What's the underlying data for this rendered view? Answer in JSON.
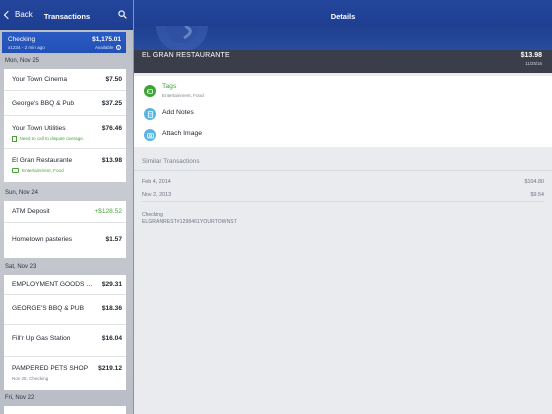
{
  "left_pane": {
    "back_label": "Back",
    "title": "Transactions",
    "account": {
      "name": "Checking",
      "balance": "$1,175.01",
      "sub": "x1234 - 2 min ago",
      "status": "Available"
    },
    "days": [
      {
        "label": "Mon, Nov 25",
        "transactions": [
          {
            "name": "Your Town Cinema",
            "amount": "$7.50"
          },
          {
            "name": "George's BBQ & Pub",
            "amount": "$37.25"
          },
          {
            "name": "Your Town Utilities",
            "amount": "$76.46",
            "note": "Need to call to dispute overage."
          },
          {
            "name": "El Gran Restaurante",
            "amount": "$13.98",
            "tags": "Entertainment, Food"
          }
        ]
      },
      {
        "label": "Sun, Nov 24",
        "transactions": [
          {
            "name": "ATM Deposit",
            "amount": "+$128.52"
          },
          {
            "name": "Hometown pasteries",
            "amount": "$1.57"
          }
        ]
      },
      {
        "label": "Sat, Nov 23",
        "transactions": [
          {
            "name": "EMPLOYMENT GOODS O...",
            "amount": "$29.31"
          },
          {
            "name": "GEORGE'S BBQ & PUB",
            "amount": "$18.36"
          },
          {
            "name": "Fill'r Up Gas Station",
            "amount": "$16.04"
          },
          {
            "name": "PAMPERED PETS SHOP",
            "amount": "$219.12",
            "sub": "Nov 25, Checking"
          }
        ]
      },
      {
        "label": "Fri, Nov 22",
        "transactions": []
      }
    ]
  },
  "detail": {
    "title": "Details",
    "merchant": "EL GRAN RESTAURANTE",
    "amount": "$13.98",
    "date": "11/25/16",
    "tags_label": "Tags",
    "tags_value": "Entertainment, Food",
    "add_notes_label": "Add Notes",
    "attach_image_label": "Attach Image",
    "similar_header": "Similar Transactions",
    "similar": [
      {
        "date": "Feb 4, 2014",
        "amount": "$104.80"
      },
      {
        "date": "Nov 2, 2013",
        "amount": "$9.54"
      }
    ],
    "account_line": "Checking",
    "raw_description": "ELGRANREST#1298461YOURTOWNST"
  },
  "colors": {
    "nav_blue": "#1d3d90",
    "account_blue": "#2250b6",
    "accent_green": "#3ea235",
    "accent_light_blue": "#5ab4e0"
  },
  "icons": {
    "back": "chevron-left-icon",
    "search": "search-icon",
    "info": "info-icon",
    "tag": "tag-icon",
    "note": "note-icon",
    "camera": "camera-icon"
  }
}
